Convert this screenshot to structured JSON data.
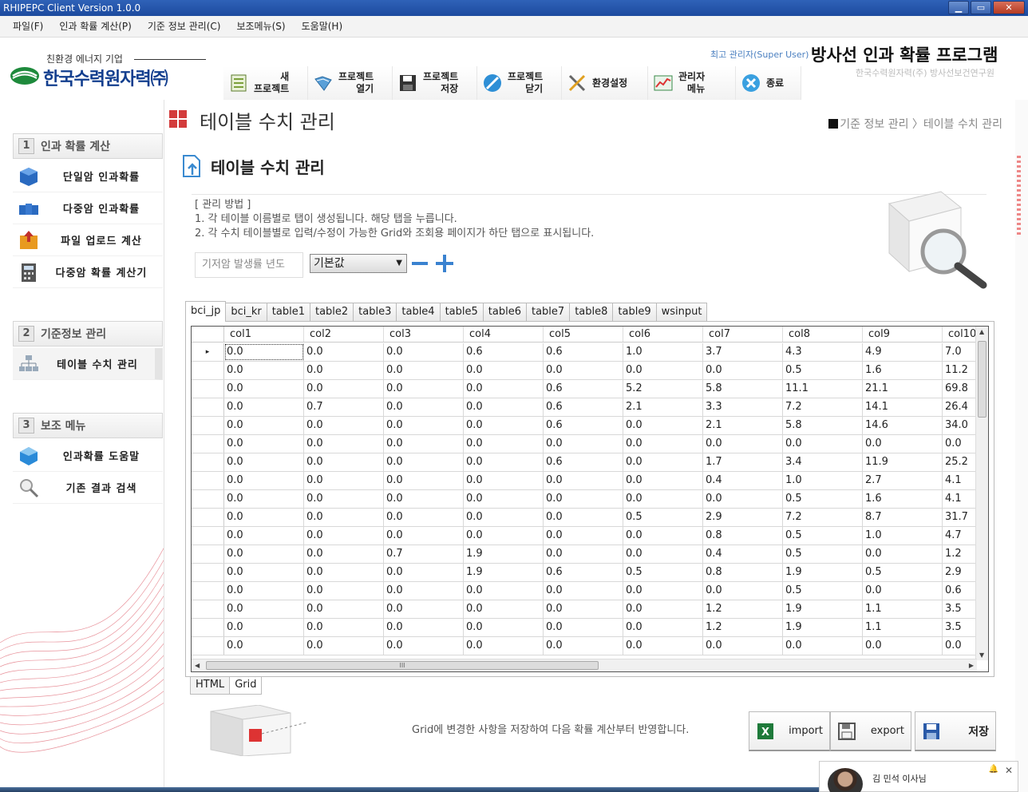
{
  "window": {
    "title": "RHIPEPC Client Version 1.0.0",
    "min": "▁",
    "max": "▭",
    "close": "✕"
  },
  "menu": [
    "파일(F)",
    "인과 확률 계산(P)",
    "기준 정보 관리(C)",
    "보조메뉴(S)",
    "도움말(H)"
  ],
  "header": {
    "logo_tag": "친환경 에너지 기업",
    "logo_name": "한국수력원자력㈜",
    "user": "최고 관리자(Super User)",
    "app_title": "방사선 인과 확률 프로그램",
    "app_sub": "한국수력원자력(주) 방사선보건연구원"
  },
  "toolbar": [
    {
      "label": "새\n프로젝트",
      "icon": "new-project-icon"
    },
    {
      "label": "프로젝트\n열기",
      "icon": "open-project-icon"
    },
    {
      "label": "프로젝트\n저장",
      "icon": "save-project-icon"
    },
    {
      "label": "프로젝트\n닫기",
      "icon": "close-project-icon"
    },
    {
      "label": "환경설정",
      "icon": "settings-icon"
    },
    {
      "label": "관리자\n메뉴",
      "icon": "admin-chart-icon"
    },
    {
      "label": "종료",
      "icon": "exit-icon"
    }
  ],
  "sidebar": {
    "sections": [
      {
        "num": "1",
        "label": "인과 확률 계산",
        "items": [
          "단일암 인과확률",
          "다중암 인과확률",
          "파일 업로드 계산",
          "다중암 확률 계산기"
        ]
      },
      {
        "num": "2",
        "label": "기준정보 관리",
        "items": [
          "테이블 수치 관리"
        ]
      },
      {
        "num": "3",
        "label": "보조 메뉴",
        "items": [
          "인과확률 도움말",
          "기존 결과 검색"
        ]
      }
    ]
  },
  "page": {
    "title": "테이블 수치 관리",
    "breadcrumb": "기준 정보 관리 〉테이블 수치 관리",
    "sub_title": "테이블 수치 관리",
    "desc_head": "[ 관리 방법 ]",
    "desc_1": "1. 각 테이블 이름별로 탭이 생성됩니다. 해당 탭을 누릅니다.",
    "desc_2": "2. 각 수치 테이블별로 입력/수정이 가능한 Grid와 조회용 페이지가 하단 탭으로 표시됩니다.",
    "year_placeholder": "기저암 발생률 년도",
    "select_value": "기본값"
  },
  "tabs": [
    "bci_jp",
    "bci_kr",
    "table1",
    "table2",
    "table3",
    "table4",
    "table5",
    "table6",
    "table7",
    "table8",
    "table9",
    "wsinput"
  ],
  "active_tab": "bci_jp",
  "grid": {
    "columns": [
      "col1",
      "col2",
      "col3",
      "col4",
      "col5",
      "col6",
      "col7",
      "col8",
      "col9",
      "col10"
    ],
    "current_row_marker": "▸",
    "rows": [
      [
        "0.0",
        "0.0",
        "0.0",
        "0.6",
        "0.6",
        "1.0",
        "3.7",
        "4.3",
        "4.9",
        "7.0"
      ],
      [
        "0.0",
        "0.0",
        "0.0",
        "0.0",
        "0.0",
        "0.0",
        "0.0",
        "0.5",
        "1.6",
        "11.2"
      ],
      [
        "0.0",
        "0.0",
        "0.0",
        "0.0",
        "0.6",
        "5.2",
        "5.8",
        "11.1",
        "21.1",
        "69.8"
      ],
      [
        "0.0",
        "0.7",
        "0.0",
        "0.0",
        "0.6",
        "2.1",
        "3.3",
        "7.2",
        "14.1",
        "26.4"
      ],
      [
        "0.0",
        "0.0",
        "0.0",
        "0.0",
        "0.6",
        "0.0",
        "2.1",
        "5.8",
        "14.6",
        "34.0"
      ],
      [
        "0.0",
        "0.0",
        "0.0",
        "0.0",
        "0.0",
        "0.0",
        "0.0",
        "0.0",
        "0.0",
        "0.0"
      ],
      [
        "0.0",
        "0.0",
        "0.0",
        "0.0",
        "0.6",
        "0.0",
        "1.7",
        "3.4",
        "11.9",
        "25.2"
      ],
      [
        "0.0",
        "0.0",
        "0.0",
        "0.0",
        "0.0",
        "0.0",
        "0.4",
        "1.0",
        "2.7",
        "4.1"
      ],
      [
        "0.0",
        "0.0",
        "0.0",
        "0.0",
        "0.0",
        "0.0",
        "0.0",
        "0.5",
        "1.6",
        "4.1"
      ],
      [
        "0.0",
        "0.0",
        "0.0",
        "0.0",
        "0.0",
        "0.5",
        "2.9",
        "7.2",
        "8.7",
        "31.7"
      ],
      [
        "0.0",
        "0.0",
        "0.0",
        "0.0",
        "0.0",
        "0.0",
        "0.8",
        "0.5",
        "1.0",
        "4.7"
      ],
      [
        "0.0",
        "0.0",
        "0.7",
        "1.9",
        "0.0",
        "0.0",
        "0.4",
        "0.5",
        "0.0",
        "1.2"
      ],
      [
        "0.0",
        "0.0",
        "0.0",
        "1.9",
        "0.6",
        "0.5",
        "0.8",
        "1.9",
        "0.5",
        "2.9"
      ],
      [
        "0.0",
        "0.0",
        "0.0",
        "0.0",
        "0.0",
        "0.0",
        "0.0",
        "0.5",
        "0.0",
        "0.6"
      ],
      [
        "0.0",
        "0.0",
        "0.0",
        "0.0",
        "0.0",
        "0.0",
        "1.2",
        "1.9",
        "1.1",
        "3.5"
      ],
      [
        "0.0",
        "0.0",
        "0.0",
        "0.0",
        "0.0",
        "0.0",
        "1.2",
        "1.9",
        "1.1",
        "3.5"
      ],
      [
        "0.0",
        "0.0",
        "0.0",
        "0.0",
        "0.0",
        "0.0",
        "0.0",
        "0.0",
        "0.0",
        "0.0"
      ]
    ],
    "hscroll_grip": "III"
  },
  "bottom_tabs": [
    "HTML",
    "Grid"
  ],
  "footer": {
    "note": "Grid에 변경한 사항을 저장하여 다음 확률 계산부터 반영합니다.",
    "import": "import",
    "export": "export",
    "save": "저장"
  },
  "toast": {
    "name": "김 민석 이사님",
    "bell": "🔔",
    "close": "✕"
  },
  "colors": {
    "brand_blue": "#123e8e",
    "accent_red": "#d33b3b",
    "titlebar": "#2f62b8"
  }
}
